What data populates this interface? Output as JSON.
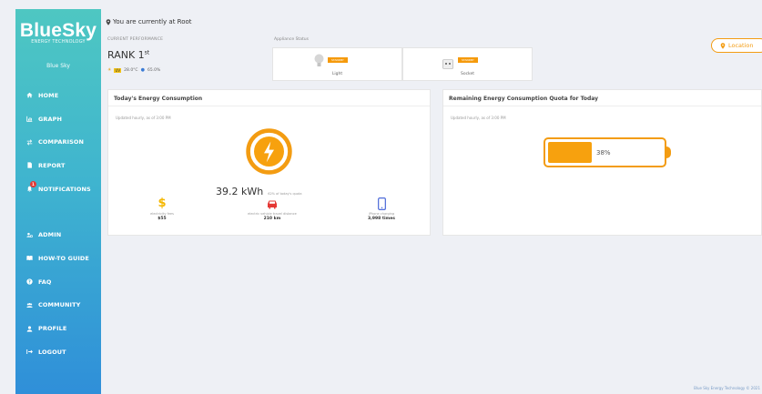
{
  "brand": {
    "name": "BlueSky",
    "subtitle": "ENERGY TECHNOLOGY",
    "user": "Blue Sky"
  },
  "nav": [
    {
      "label": "HOME",
      "icon": "home-icon"
    },
    {
      "label": "GRAPH",
      "icon": "chart-icon"
    },
    {
      "label": "COMPARISON",
      "icon": "compare-icon"
    },
    {
      "label": "REPORT",
      "icon": "file-icon"
    },
    {
      "label": "NOTIFICATIONS",
      "icon": "bell-icon",
      "badge": "1"
    },
    {
      "label": "ADMIN",
      "icon": "users-cog-icon"
    },
    {
      "label": "HOW-TO GUIDE",
      "icon": "book-icon"
    },
    {
      "label": "FAQ",
      "icon": "question-icon"
    },
    {
      "label": "COMMUNITY",
      "icon": "community-icon"
    },
    {
      "label": "PROFILE",
      "icon": "user-icon"
    },
    {
      "label": "LOGOUT",
      "icon": "logout-icon"
    }
  ],
  "header": {
    "location_text": "You are currently at Root",
    "perf_label": "CURRENT PERFORMANCE",
    "rank": "RANK 1",
    "rank_suffix": "st",
    "uv": "UV",
    "temperature": "28.0°C",
    "humidity": "65.0%",
    "appliance_label": "Appliance Status",
    "appliances": [
      {
        "name": "Light",
        "status": "STANDBY",
        "icon": "lightbulb-icon"
      },
      {
        "name": "Socket",
        "status": "STANDBY",
        "icon": "socket-icon"
      }
    ],
    "location_button": "Location"
  },
  "energy_card": {
    "title": "Today's Energy Consumption",
    "updated": "Updated hourly, as of 3:00 PM",
    "value": "39.2 kWh",
    "quota_note": "62% of today's quota",
    "stats": [
      {
        "label": "electricity fees",
        "value": "$55",
        "icon": "dollar-icon"
      },
      {
        "label": "electric vehicle travel distance",
        "value": "210 km",
        "icon": "car-icon"
      },
      {
        "label": "iPhone charging",
        "value": "3,998 times",
        "icon": "phone-icon"
      }
    ]
  },
  "quota_card": {
    "title": "Remaining Energy Consumption Quota for Today",
    "updated": "Updated hourly, as of 3:00 PM",
    "percent_text": "38%",
    "percent": 38
  },
  "footer": "Blue Sky Energy Technology © 2021",
  "colors": {
    "accent": "#f39c12",
    "sidebar_top": "#4ec7c2",
    "sidebar_bottom": "#2f8fd9"
  }
}
